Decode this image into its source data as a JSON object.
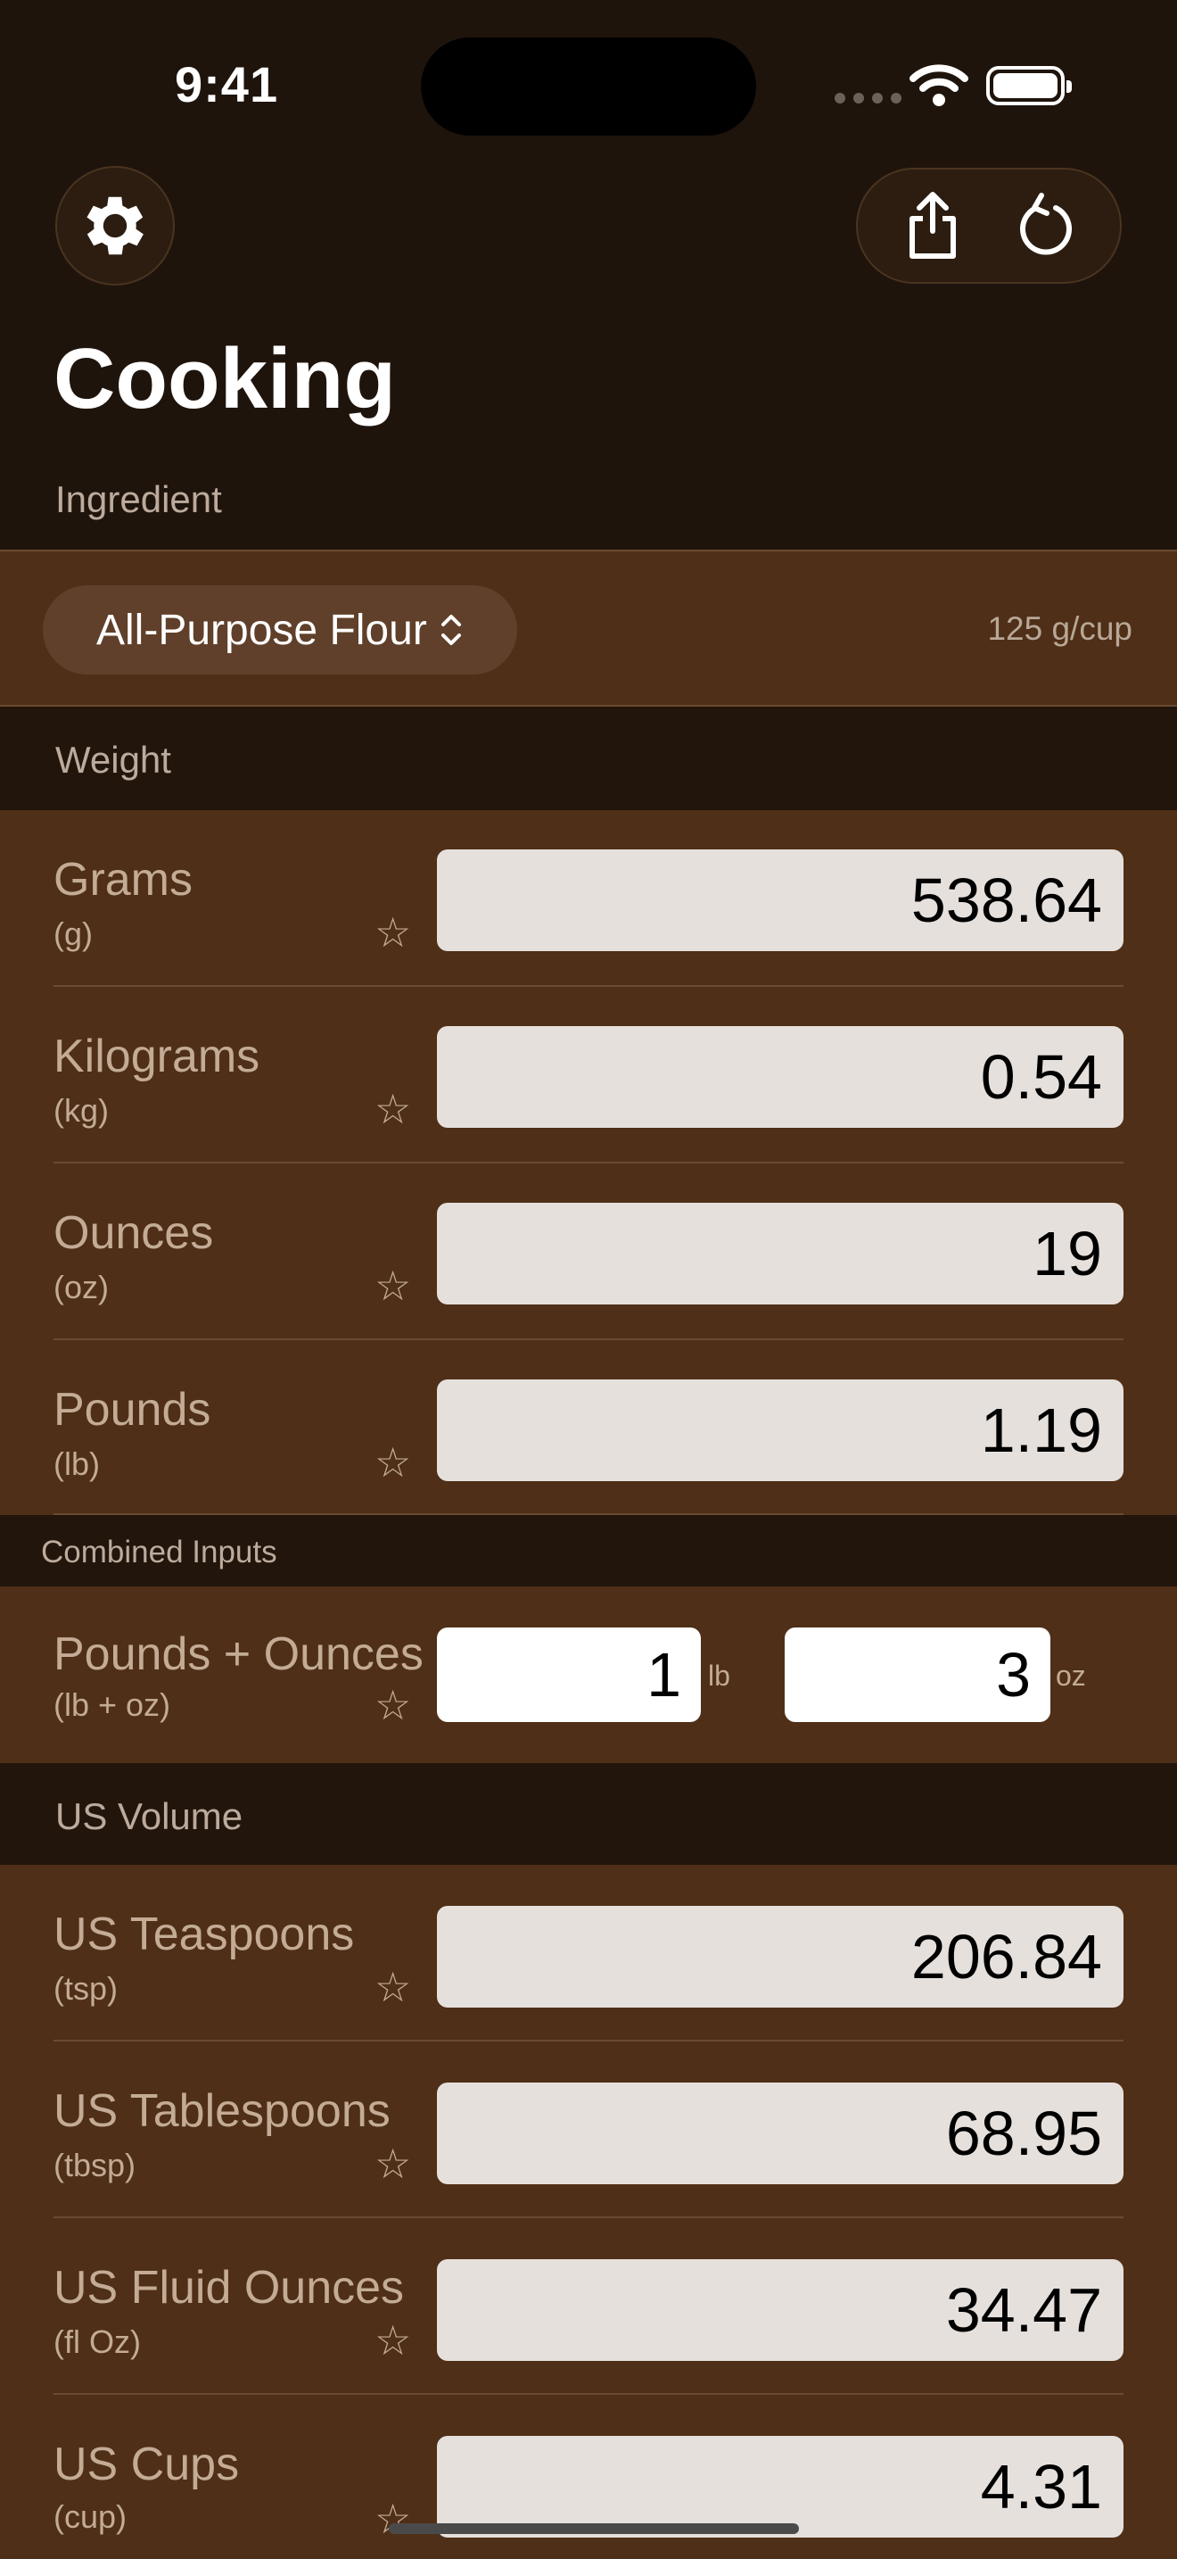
{
  "status_bar": {
    "time": "9:41"
  },
  "header": {
    "title": "Cooking",
    "ingredient_label": "Ingredient"
  },
  "ingredient": {
    "selected": "All-Purpose Flour",
    "density": "125 g/cup"
  },
  "sections": {
    "weight": "Weight",
    "combined": "Combined Inputs",
    "us_volume": "US Volume"
  },
  "weight_rows": [
    {
      "name": "Grams",
      "unit": "(g)",
      "value": "538.64"
    },
    {
      "name": "Kilograms",
      "unit": "(kg)",
      "value": "0.54"
    },
    {
      "name": "Ounces",
      "unit": "(oz)",
      "value": "19"
    },
    {
      "name": "Pounds",
      "unit": "(lb)",
      "value": "1.19"
    }
  ],
  "combined_row": {
    "name": "Pounds + Ounces",
    "unit": "(lb + oz)",
    "lb_value": "1",
    "lb_suffix": "lb",
    "oz_value": "3",
    "oz_suffix": "oz"
  },
  "volume_rows": [
    {
      "name": "US Teaspoons",
      "unit": "(tsp)",
      "value": "206.84"
    },
    {
      "name": "US Tablespoons",
      "unit": "(tbsp)",
      "value": "68.95"
    },
    {
      "name": "US Fluid Ounces",
      "unit": "(fl Oz)",
      "value": "34.47"
    },
    {
      "name": "US Cups",
      "unit": "(cup)",
      "value": "4.31"
    }
  ],
  "icons": {
    "settings": "gear-icon",
    "share": "share-icon",
    "reset": "reset-icon",
    "favorite": "star-outline-icon"
  },
  "colors": {
    "background": "#1f140c",
    "band": "#4f2f17",
    "field": "#e6e0dd"
  }
}
